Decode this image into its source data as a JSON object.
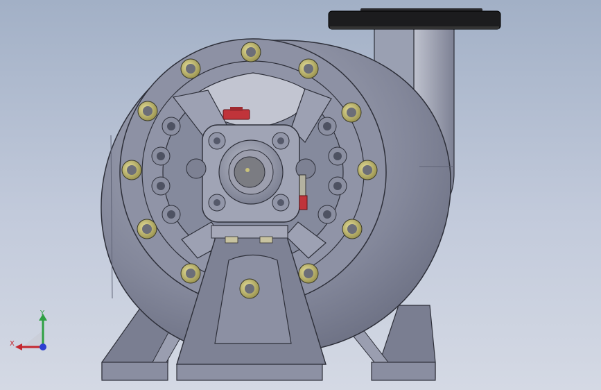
{
  "viewport": {
    "background_top": "#a2b0c6",
    "background_bottom": "#d4d9e4"
  },
  "model": {
    "body_color": "#8b8fa2",
    "flange_color": "#1c1c1e",
    "accent_color": "#c0343a",
    "bolt_face_color": "#c9c27a"
  },
  "triad": {
    "x_label": "X",
    "y_label": "Y",
    "x_color": "#c4262e",
    "y_color": "#2ea043",
    "z_color": "#2c3fd1"
  }
}
